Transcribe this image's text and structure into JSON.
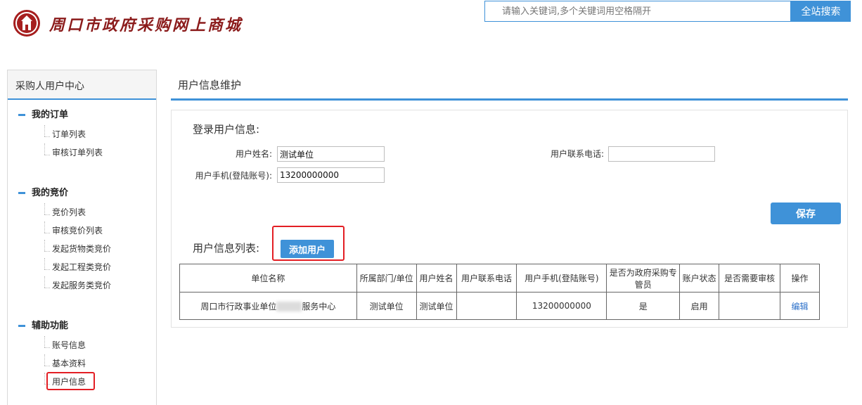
{
  "header": {
    "site_title": "周口市政府采购网上商城",
    "search_placeholder": "请输入关键词,多个关键词用空格隔开",
    "search_button": "全站搜索",
    "brand_color": "#8b1b1b",
    "accent_color": "#3f92d8"
  },
  "sidebar": {
    "title": "采购人用户中心",
    "groups": [
      {
        "title": "我的订单",
        "items": [
          "订单列表",
          "审核订单列表"
        ]
      },
      {
        "title": "我的竞价",
        "items": [
          "竞价列表",
          "审核竞价列表",
          "发起货物类竞价",
          "发起工程类竞价",
          "发起服务类竞价"
        ]
      },
      {
        "title": "辅助功能",
        "items": [
          "账号信息",
          "基本资料",
          "用户信息"
        ]
      }
    ]
  },
  "main": {
    "title": "用户信息维护",
    "login_section": "登录用户信息:",
    "fields": {
      "name_label": "用户姓名:",
      "name_value": "测试单位",
      "phone_label": "用户联系电话:",
      "phone_value": "",
      "mobile_label": "用户手机(登陆账号):",
      "mobile_value": "13200000000"
    },
    "save_button": "保存",
    "list_section": "用户信息列表:",
    "add_button": "添加用户",
    "table": {
      "headers": [
        "单位名称",
        "所属部门/单位",
        "用户姓名",
        "用户联系电话",
        "用户手机(登陆账号)",
        "是否为政府采购专管员",
        "账户状态",
        "是否需要审核",
        "操作"
      ],
      "rows": [
        {
          "unit_prefix": "周口市行政事业单位",
          "unit_suffix": "服务中心",
          "dept": "测试单位",
          "name": "测试单位",
          "phone": "",
          "mobile": "13200000000",
          "is_manager": "是",
          "status": "启用",
          "need_audit": "",
          "action": "编辑"
        }
      ]
    }
  }
}
